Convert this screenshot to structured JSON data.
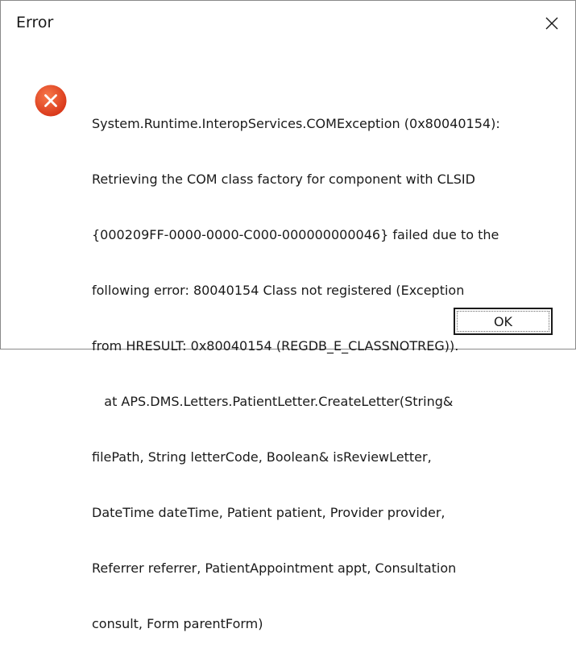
{
  "window": {
    "title": "Error"
  },
  "message": {
    "lines": [
      "System.Runtime.InteropServices.COMException (0x80040154):",
      "Retrieving the COM class factory for component with CLSID",
      "{000209FF-0000-0000-C000-000000000046} failed due to the",
      "following error: 80040154 Class not registered (Exception",
      "from HRESULT: 0x80040154 (REGDB_E_CLASSNOTREG)).",
      "   at APS.DMS.Letters.PatientLetter.CreateLetter(String&",
      "filePath, String letterCode, Boolean& isReviewLetter,",
      "DateTime dateTime, Patient patient, Provider provider,",
      "Referrer referrer, PatientAppointment appt, Consultation",
      "consult, Form parentForm)"
    ]
  },
  "buttons": {
    "ok_label": "OK"
  },
  "icons": {
    "close": "close-icon",
    "error": "error-icon"
  },
  "colors": {
    "error_icon_fill": "#e8491d",
    "accent_edge": "#1f6fd1"
  }
}
